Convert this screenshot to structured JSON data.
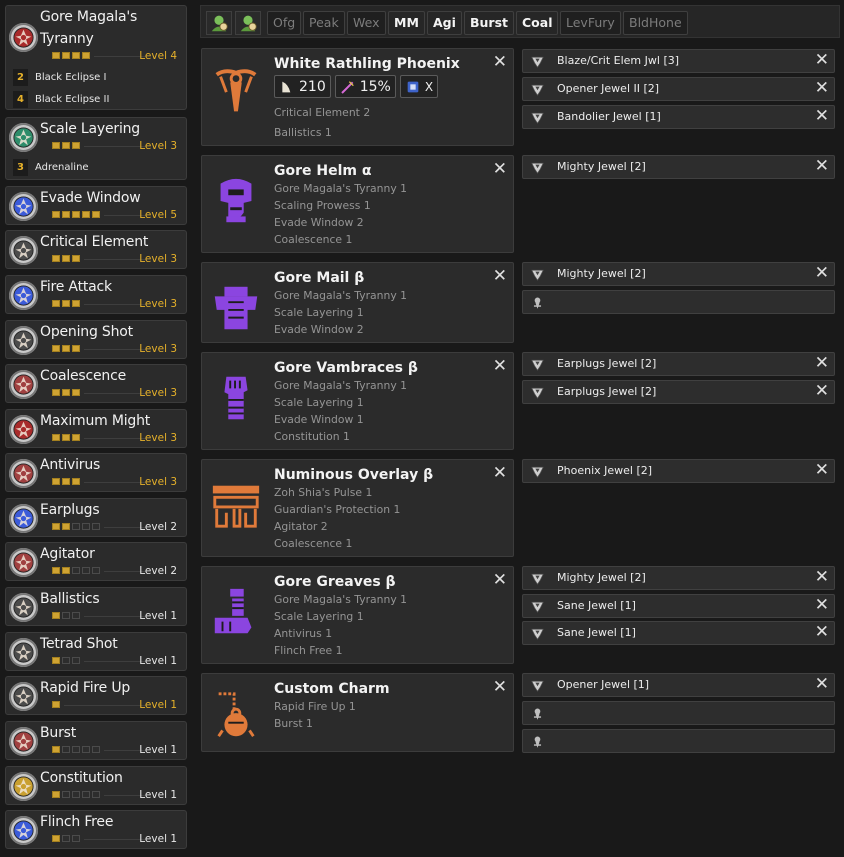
{
  "skills": [
    {
      "name": "Gore Magala's Tyranny",
      "level_label": "Level 4",
      "filled": 4,
      "total": 4,
      "max": true,
      "icon": "tyranny-icon",
      "color": "#a82b2b",
      "bonuses": [
        {
          "num": "2",
          "label": "Black Eclipse I"
        },
        {
          "num": "4",
          "label": "Black Eclipse II"
        }
      ]
    },
    {
      "name": "Scale Layering",
      "level_label": "Level 3",
      "filled": 3,
      "total": 3,
      "max": true,
      "icon": "scale-icon",
      "color": "#2e8c6a",
      "bonuses": [
        {
          "num": "3",
          "label": "Adrenaline"
        }
      ]
    },
    {
      "name": "Evade Window",
      "level_label": "Level 5",
      "filled": 5,
      "total": 5,
      "max": true,
      "icon": "evade-icon",
      "color": "#3b5bd9"
    },
    {
      "name": "Critical Element",
      "level_label": "Level 3",
      "filled": 3,
      "total": 3,
      "max": true,
      "icon": "critical-element-icon",
      "color": "#4b4b4b"
    },
    {
      "name": "Fire Attack",
      "level_label": "Level 3",
      "filled": 3,
      "total": 3,
      "max": true,
      "icon": "fire-attack-icon",
      "color": "#3b5bd9"
    },
    {
      "name": "Opening Shot",
      "level_label": "Level 3",
      "filled": 3,
      "total": 3,
      "max": true,
      "icon": "opening-shot-icon",
      "color": "#4b4b4b"
    },
    {
      "name": "Coalescence",
      "level_label": "Level 3",
      "filled": 3,
      "total": 3,
      "max": true,
      "icon": "coalescence-icon",
      "color": "#a04040"
    },
    {
      "name": "Maximum Might",
      "level_label": "Level 3",
      "filled": 3,
      "total": 3,
      "max": true,
      "icon": "maximum-might-icon",
      "color": "#a82b2b"
    },
    {
      "name": "Antivirus",
      "level_label": "Level 3",
      "filled": 3,
      "total": 3,
      "max": true,
      "icon": "antivirus-icon",
      "color": "#a04040"
    },
    {
      "name": "Earplugs",
      "level_label": "Level 2",
      "filled": 2,
      "total": 5,
      "max": false,
      "icon": "earplugs-icon",
      "color": "#3b5bd9"
    },
    {
      "name": "Agitator",
      "level_label": "Level 2",
      "filled": 2,
      "total": 5,
      "max": false,
      "icon": "agitator-icon",
      "color": "#a04040"
    },
    {
      "name": "Ballistics",
      "level_label": "Level 1",
      "filled": 1,
      "total": 3,
      "max": false,
      "icon": "ballistics-icon",
      "color": "#4b4b4b"
    },
    {
      "name": "Tetrad Shot",
      "level_label": "Level 1",
      "filled": 1,
      "total": 3,
      "max": false,
      "icon": "tetrad-shot-icon",
      "color": "#4b4b4b"
    },
    {
      "name": "Rapid Fire Up",
      "level_label": "Level 1",
      "filled": 1,
      "total": 1,
      "max": true,
      "icon": "rapid-fire-up-icon",
      "color": "#4b4b4b"
    },
    {
      "name": "Burst",
      "level_label": "Level 1",
      "filled": 1,
      "total": 5,
      "max": false,
      "icon": "burst-icon",
      "color": "#a04040"
    },
    {
      "name": "Constitution",
      "level_label": "Level 1",
      "filled": 1,
      "total": 5,
      "max": false,
      "icon": "constitution-icon",
      "color": "#c9a030"
    },
    {
      "name": "Flinch Free",
      "level_label": "Level 1",
      "filled": 1,
      "total": 3,
      "max": false,
      "icon": "flinch-free-icon",
      "color": "#3b5bd9"
    }
  ],
  "filters": {
    "icons": [
      "hunter-green-icon",
      "palico-green-icon"
    ],
    "chips": [
      {
        "label": "Ofg",
        "on": false
      },
      {
        "label": "Peak",
        "on": false
      },
      {
        "label": "Wex",
        "on": false
      },
      {
        "label": "MM",
        "on": true
      },
      {
        "label": "Agi",
        "on": true
      },
      {
        "label": "Burst",
        "on": true
      },
      {
        "label": "Coal",
        "on": true
      },
      {
        "label": "LevFury",
        "on": false
      },
      {
        "label": "BldHone",
        "on": false
      }
    ]
  },
  "weapon_stats": {
    "attack": "210",
    "affinity": "15%",
    "extra": "X"
  },
  "pieces": [
    {
      "name": "White Rathling Phoenix",
      "type": "weapon",
      "icon": "bow-icon",
      "color": "#e07a3a",
      "skills": [
        "Critical Element 2",
        "Ballistics 1"
      ],
      "slots": [
        "Blaze/Crit Elem Jwl [3]",
        "Opener Jewel II [2]",
        "Bandolier Jewel [1]"
      ]
    },
    {
      "name": "Gore Helm α",
      "type": "armor",
      "icon": "helm-icon",
      "color": "#8b45e0",
      "skills": [
        "Gore Magala's Tyranny 1",
        "Scaling Prowess 1",
        "Evade Window 2",
        "Coalescence 1"
      ],
      "slots": [
        "Mighty Jewel [2]"
      ]
    },
    {
      "name": "Gore Mail β",
      "type": "armor",
      "icon": "chest-icon",
      "color": "#8b45e0",
      "skills": [
        "Gore Magala's Tyranny 1",
        "Scale Layering 1",
        "Evade Window 2"
      ],
      "slots": [
        "Mighty Jewel [2]",
        ""
      ]
    },
    {
      "name": "Gore Vambraces β",
      "type": "armor",
      "icon": "arms-icon",
      "color": "#8b45e0",
      "skills": [
        "Gore Magala's Tyranny 1",
        "Scale Layering 1",
        "Evade Window 1",
        "Constitution 1"
      ],
      "slots": [
        "Earplugs Jewel [2]",
        "Earplugs Jewel [2]"
      ]
    },
    {
      "name": "Numinous Overlay β",
      "type": "armor",
      "icon": "waist-icon",
      "color": "#e07a3a",
      "skills": [
        "Zoh Shia's Pulse 1",
        "Guardian's Protection 1",
        "Agitator 2",
        "Coalescence 1"
      ],
      "slots": [
        "Phoenix Jewel [2]"
      ]
    },
    {
      "name": "Gore Greaves β",
      "type": "armor",
      "icon": "legs-icon",
      "color": "#8b45e0",
      "skills": [
        "Gore Magala's Tyranny 1",
        "Scale Layering 1",
        "Antivirus 1",
        "Flinch Free 1"
      ],
      "slots": [
        "Mighty Jewel [2]",
        "Sane Jewel [1]",
        "Sane Jewel [1]"
      ]
    },
    {
      "name": "Custom Charm",
      "type": "charm",
      "icon": "charm-icon",
      "color": "#e07a3a",
      "skills": [
        "Rapid Fire Up 1",
        "Burst 1"
      ],
      "slots": [
        "Opener Jewel [1]",
        "",
        ""
      ]
    }
  ]
}
